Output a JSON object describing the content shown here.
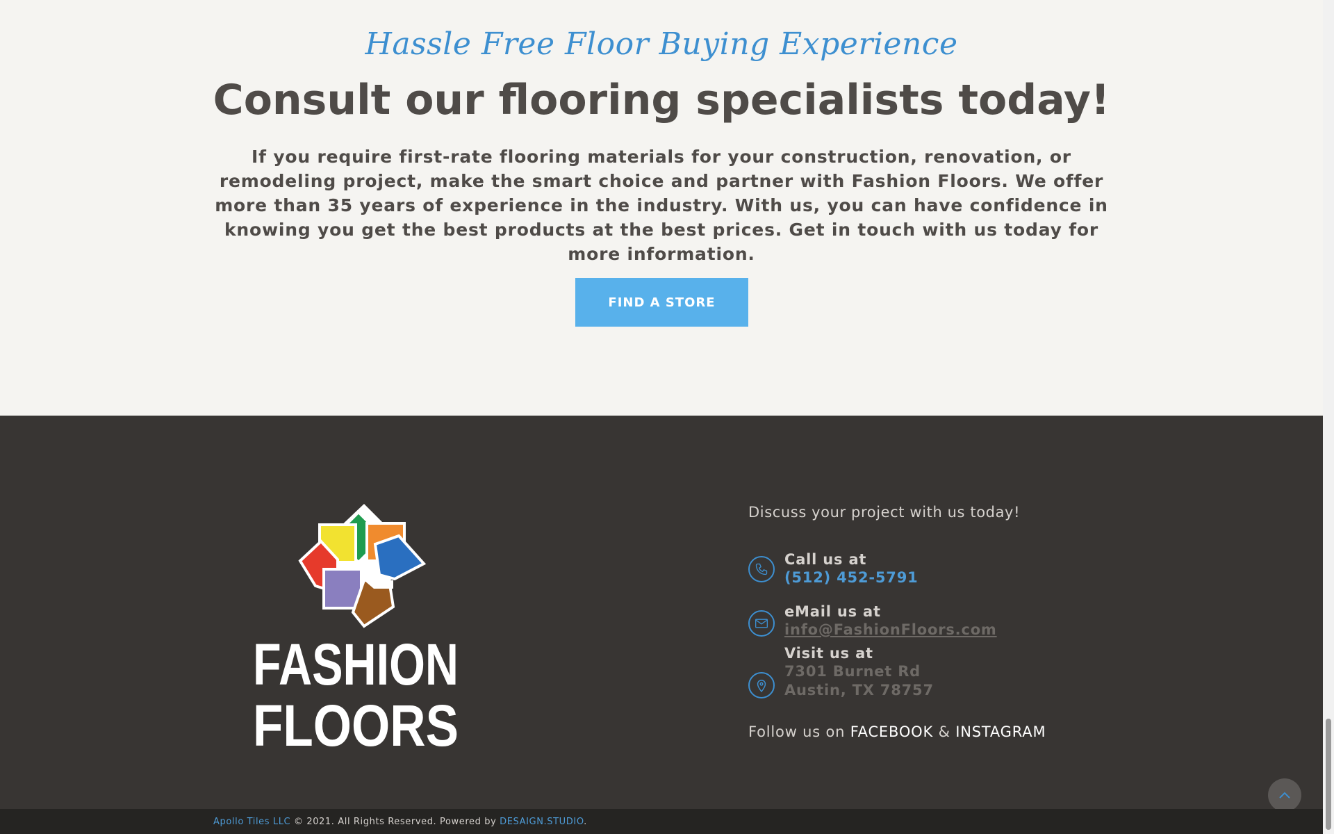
{
  "cta": {
    "tagline": "Hassle Free Floor Buying Experience",
    "headline": "Consult our flooring specialists today!",
    "intro": "If you require first-rate flooring materials for your construction, renovation, or remodeling project, make the smart choice and partner with Fashion Floors. We offer more than 35 years of experience in the industry. With us, you can have confidence in knowing you get the best products at the best prices. Get in touch with us today for more information.",
    "button_label": "FIND A STORE"
  },
  "footer": {
    "logo": {
      "line1": "FASHION",
      "line2": "FLOORS",
      "colors": {
        "green": "#1f9c4f",
        "orange": "#f08b2e",
        "yellow": "#f2e230",
        "blue": "#2a6fc0",
        "red": "#e63a2b",
        "purple": "#8a7fbf",
        "brown": "#9a5a1f"
      }
    },
    "discuss": "Discuss your project with us today!",
    "call": {
      "label": "Call us at",
      "value": "(512) 452-5791",
      "icon": "phone-icon"
    },
    "email": {
      "label": "eMail us at",
      "value": "info@FashionFloors.com",
      "icon": "mail-icon"
    },
    "visit": {
      "label": "Visit us at",
      "line1": "7301 Burnet Rd",
      "line2": "Austin, TX 78757",
      "icon": "map-pin-icon"
    },
    "follow": {
      "prefix": "Follow us on",
      "facebook": "FACEBOOK",
      "amp": "&",
      "instagram": "INSTAGRAM"
    },
    "scroll_top_icon": "chevron-up-icon"
  },
  "bottombar": {
    "company": "Apollo Tiles LLC",
    "copyright": "© 2021. All Rights Reserved. Powered by",
    "powered_by": "DESAIGN.STUDIO",
    "period": "."
  },
  "colors": {
    "accent": "#58b1eb",
    "accent_dark": "#3d8fd0",
    "cta_bg": "#f5f4f1",
    "footer_bg": "#383533",
    "bottombar_bg": "#252422"
  }
}
